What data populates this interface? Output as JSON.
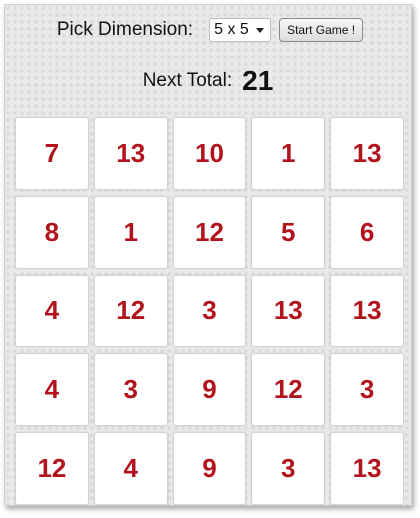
{
  "controls": {
    "pick_label": "Pick Dimension:",
    "dimension_selected": "5 x 5",
    "start_label": "Start Game !"
  },
  "status": {
    "next_total_label": "Next Total:",
    "next_total_value": "21"
  },
  "grid": {
    "rows": [
      [
        "7",
        "13",
        "10",
        "1",
        "13"
      ],
      [
        "8",
        "1",
        "12",
        "5",
        "6"
      ],
      [
        "4",
        "12",
        "3",
        "13",
        "13"
      ],
      [
        "4",
        "3",
        "9",
        "12",
        "3"
      ],
      [
        "12",
        "4",
        "9",
        "3",
        "13"
      ]
    ]
  },
  "colors": {
    "tile_number": "#b2141d",
    "background": "#e9e9e9"
  },
  "icons": {
    "select_caret": "chevron-down-icon"
  }
}
